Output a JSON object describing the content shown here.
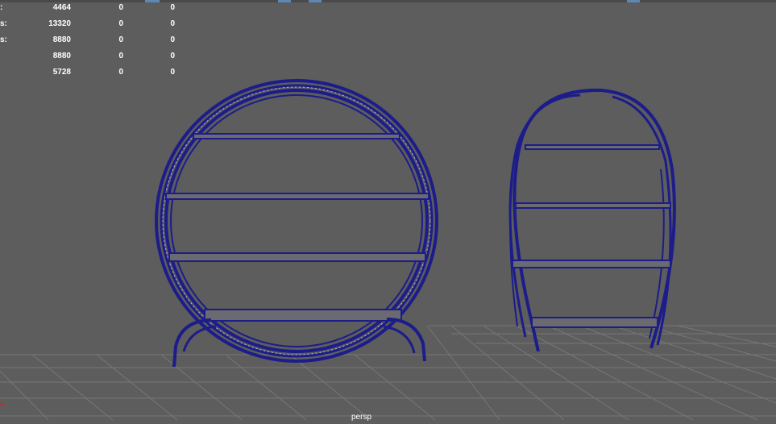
{
  "viewport": {
    "camera": "persp",
    "wireframe_color": "#1c1c8a",
    "background_color": "#5d5d5d",
    "grid_color": "#777777"
  },
  "hud": {
    "rows": [
      {
        "label": ":",
        "col1": "4464",
        "col2": "0",
        "col3": "0"
      },
      {
        "label": "s:",
        "col1": "13320",
        "col2": "0",
        "col3": "0"
      },
      {
        "label": "s:",
        "col1": "8880",
        "col2": "0",
        "col3": "0"
      },
      {
        "label": "",
        "col1": "8880",
        "col2": "0",
        "col3": "0"
      },
      {
        "label": "",
        "col1": "5728",
        "col2": "0",
        "col3": "0"
      }
    ]
  },
  "objects": [
    {
      "name": "round-bookshelf",
      "shelves": 4
    },
    {
      "name": "oval-bookshelf",
      "shelves": 4
    }
  ],
  "icons": [
    "axis-marker-icon"
  ]
}
